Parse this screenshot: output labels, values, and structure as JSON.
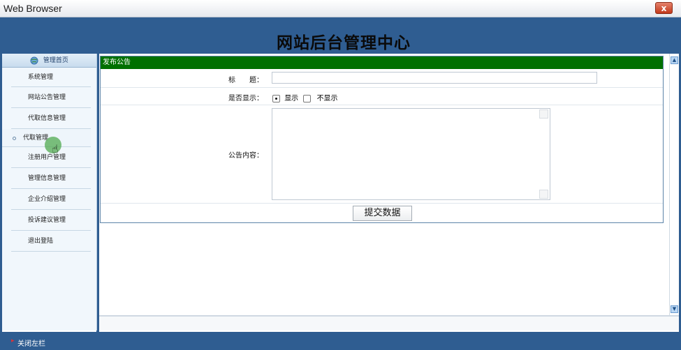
{
  "window": {
    "title": "Web Browser",
    "close_label": "x"
  },
  "header": {
    "site_title": "网站后台管理中心"
  },
  "sidebar": {
    "home_label": "管理首页",
    "items": [
      {
        "label": "系统管理"
      },
      {
        "label": "网站公告管理"
      },
      {
        "label": "代取信息管理"
      },
      {
        "label": "代取管理",
        "active": true
      },
      {
        "label": "注册用户管理"
      },
      {
        "label": "管理信息管理"
      },
      {
        "label": "企业介绍管理"
      },
      {
        "label": "投诉建议管理"
      },
      {
        "label": "退出登陆"
      }
    ]
  },
  "form": {
    "panel_title": "发布公告",
    "title_label": "标　　题：",
    "title_value": "",
    "show_label": "是否显示：",
    "show_options": [
      "显示",
      "不显示"
    ],
    "show_selected": "显示",
    "content_label": "公告内容：",
    "content_value": "",
    "submit_label": "提交数据"
  },
  "footer": {
    "close_sidebar_label": "关闭左栏"
  },
  "colors": {
    "header": "#2f5d91",
    "panel_head": "#007000",
    "close_button": "#c2391b"
  }
}
